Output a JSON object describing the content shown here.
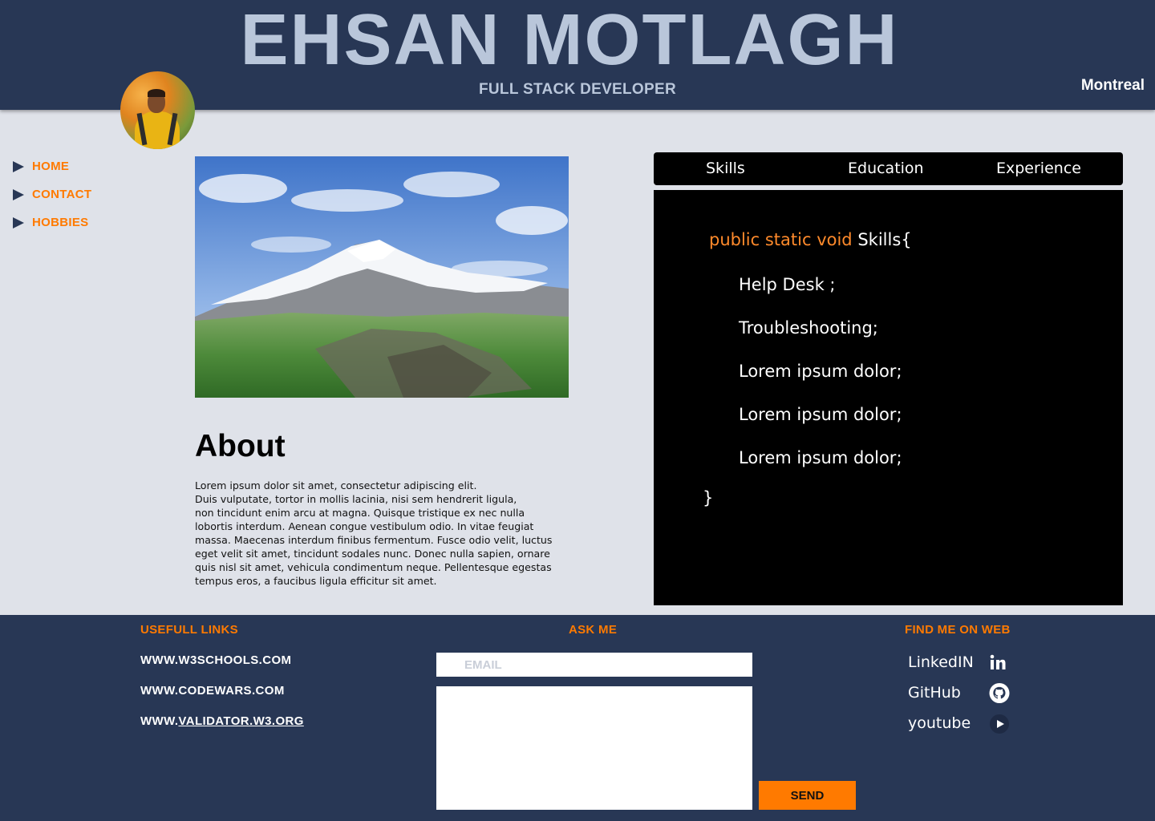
{
  "header": {
    "name": "EHSAN MOTLAGH",
    "role": "FULL STACK DEVELOPER",
    "city": "Montreal"
  },
  "nav": {
    "items": [
      {
        "label": "HOME"
      },
      {
        "label": "CONTACT"
      },
      {
        "label": "HOBBIES"
      }
    ]
  },
  "about": {
    "title": "About",
    "text": "Lorem ipsum dolor sit amet, consectetur adipiscing elit.\nDuis vulputate, tortor in mollis lacinia, nisi sem hendrerit ligula,\nnon tincidunt enim arcu at magna. Quisque tristique ex nec nulla\n lobortis interdum. Aenean congue vestibulum odio. In vitae feugiat\nmassa. Maecenas interdum finibus fermentum. Fusce odio velit, luctus\neget velit sit amet, tincidunt sodales nunc. Donec nulla sapien, ornare\nquis nisl sit amet, vehicula condimentum neque. Pellentesque egestas\ntempus eros, a faucibus ligula efficitur sit amet."
  },
  "tabs": [
    {
      "label": "Skills"
    },
    {
      "label": "Education"
    },
    {
      "label": "Experience"
    }
  ],
  "code": {
    "keyword": "public static void",
    "name": "Skills{",
    "lines": [
      "Help Desk ;",
      "Troubleshooting;",
      "Lorem ipsum dolor;",
      "Lorem ipsum dolor;",
      "Lorem ipsum dolor;"
    ],
    "close": "}"
  },
  "footer": {
    "links_heading": "USEFULL LINKS",
    "links": [
      {
        "prefix": "WWW.W3SCHOOLS.COM",
        "underlined": ""
      },
      {
        "prefix": "WWW.CODEWARS.COM",
        "underlined": ""
      },
      {
        "prefix": "WWW.",
        "underlined": "VALIDATOR.W3.ORG"
      }
    ],
    "ask_heading": "ASK ME",
    "email_placeholder": "EMAIL",
    "send_label": "SEND",
    "web_heading": "FIND ME ON WEB",
    "social": [
      {
        "label": "LinkedIN",
        "icon": "linkedin-icon"
      },
      {
        "label": "GitHub",
        "icon": "github-icon"
      },
      {
        "label": "youtube",
        "icon": "youtube-icon"
      }
    ]
  },
  "colors": {
    "navy": "#283755",
    "accent": "#ff7a00",
    "page_bg": "#dfe2e9",
    "title": "#b9c6da"
  }
}
